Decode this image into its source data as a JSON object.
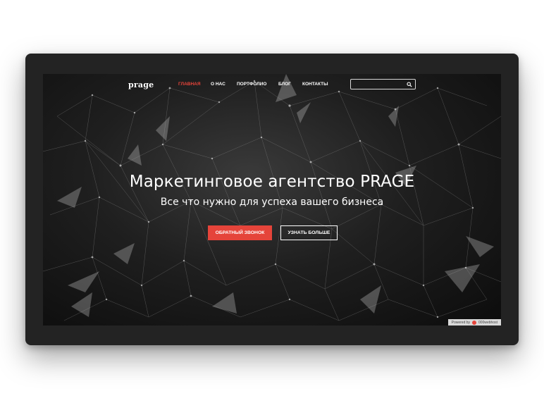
{
  "site": {
    "logo": "prage"
  },
  "nav": {
    "items": [
      {
        "label": "ГЛАВНАЯ",
        "active": true
      },
      {
        "label": "О НАС",
        "active": false
      },
      {
        "label": "ПОРТФОЛИО",
        "active": false
      },
      {
        "label": "БЛОГ",
        "active": false
      },
      {
        "label": "КОНТАКТЫ",
        "active": false
      }
    ]
  },
  "search": {
    "value": "",
    "placeholder": "",
    "icon": "search-icon"
  },
  "hero": {
    "title": "Маркетинговое агентство PRAGE",
    "subtitle": "Все что нужно для успеха вашего бизнеса",
    "primary_button": "ОБРАТНЫЙ ЗВОНОК",
    "secondary_button": "УЗНАТЬ БОЛЬШЕ"
  },
  "badge": {
    "powered_by": "Powered by",
    "brand": "000webhost"
  },
  "colors": {
    "accent": "#e5443a",
    "background": "#1a1a1a",
    "device_frame": "#232323"
  }
}
